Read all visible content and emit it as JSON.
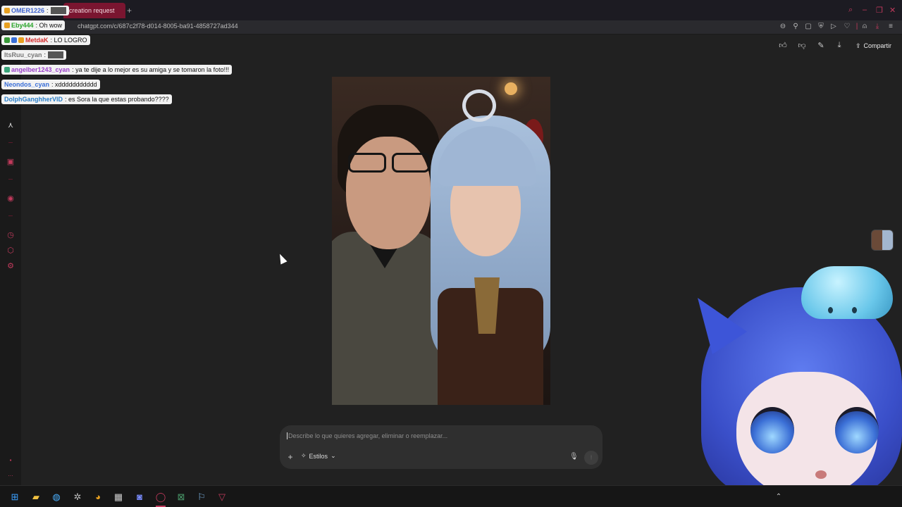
{
  "browser": {
    "tab_title": "creation request",
    "tab_add": "+",
    "url": "chatgpt.com/c/687c2f78-d014-8005-ba91-4858727ad344"
  },
  "chat": {
    "messages": [
      {
        "user": "OMER1226",
        "text": "",
        "user_color": "#3a5fcf",
        "emote": true
      },
      {
        "user": "Eby444",
        "text": "Oh wow",
        "user_color": "#2aa52a",
        "emote": false
      },
      {
        "user": "MetdaK",
        "text": "LO LOGRO",
        "user_color": "#d42a2a",
        "emote": false
      },
      {
        "user": "ItsRuu_cyan",
        "text": "",
        "user_color": "#777777",
        "emote": true
      },
      {
        "user": "angelber1243_cyan",
        "text": "ya te dije a lo mejor es su amiga y se tomaron la foto!!!",
        "user_color": "#9a3fc9",
        "emote": false
      },
      {
        "user": "Neondos_cyan",
        "text": "xddddddddddd",
        "user_color": "#3a6fd8",
        "emote": false
      },
      {
        "user": "DolphGanghherVID",
        "text": "es Sora la que estas probando????",
        "user_color": "#2a7fc9",
        "emote": false
      }
    ]
  },
  "actions": {
    "share_label": "Compartir"
  },
  "prompt": {
    "placeholder": "Describe lo que quieres agregar, eliminar o reemplazar...",
    "styles_label": "Estilos",
    "plus_label": "+"
  },
  "colors": {
    "accent": "#c23a5c",
    "background": "#212121",
    "prompt_bg": "#2f2f2f"
  },
  "icons": {
    "zoom": "search-icon",
    "thumbs_up": "thumbs-up-icon",
    "thumbs_down": "thumbs-down-icon",
    "edit": "edit-icon",
    "download": "download-icon",
    "share": "share-icon",
    "mic": "microphone-icon",
    "voice": "voice-mode-icon"
  }
}
